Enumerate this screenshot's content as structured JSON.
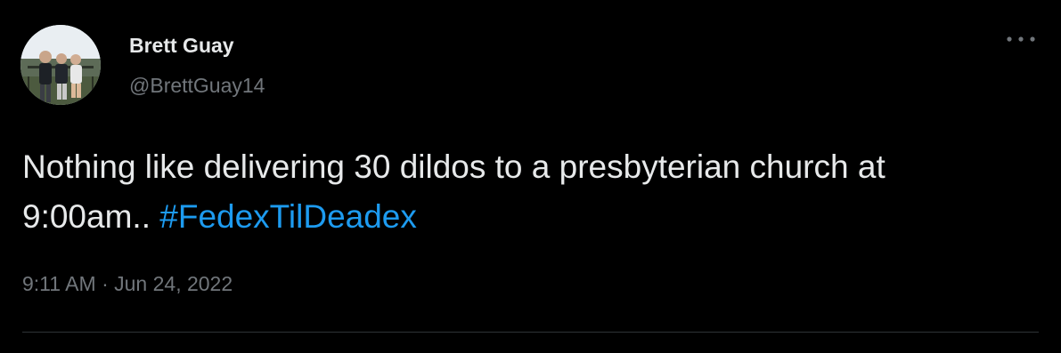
{
  "user": {
    "display_name": "Brett Guay",
    "handle": "@BrettGuay14"
  },
  "tweet": {
    "text": "Nothing like delivering 30 dildos to a presbyterian church at 9:00am.. ",
    "hashtag": "#FedexTilDeadex"
  },
  "meta": {
    "time": "9:11 AM",
    "separator": "·",
    "date": "Jun 24, 2022"
  },
  "icons": {
    "avatar": "avatar-photo",
    "more": "more-horizontal-icon"
  },
  "colors": {
    "background": "#000000",
    "primary_text": "#e7e9ea",
    "secondary_text": "#71767b",
    "link": "#1d9bf0",
    "divider": "#2f3336"
  }
}
